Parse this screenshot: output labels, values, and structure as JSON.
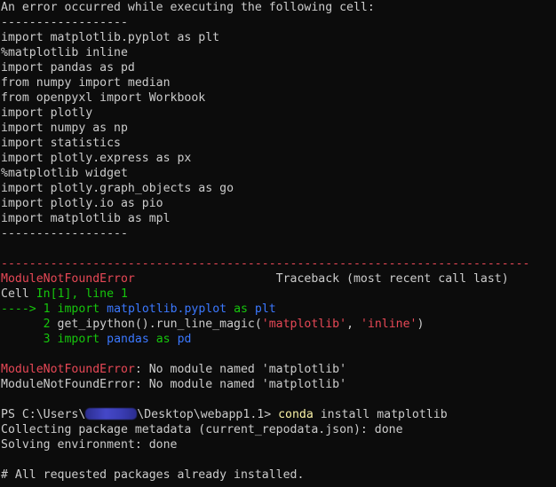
{
  "error_header": {
    "intro": "An error occurred while executing the following cell:",
    "separator_top": "------------------",
    "code_lines": [
      "import matplotlib.pyplot as plt",
      "%matplotlib inline",
      "import pandas as pd",
      "from numpy import median",
      "from openpyxl import Workbook",
      "import plotly",
      "import numpy as np",
      "import statistics",
      "import plotly.express as px",
      "%matplotlib widget",
      "import plotly.graph_objects as go",
      "import plotly.io as pio",
      "import matplotlib as mpl"
    ],
    "separator_bottom": "------------------"
  },
  "traceback": {
    "rule": "---------------------------------------------------------------------------",
    "error_name": "ModuleNotFoundError",
    "traceback_label": "Traceback (most recent call last)",
    "cell_prefix": "Cell ",
    "cell_ref": "In[1], line 1",
    "arrow": "----> 1 ",
    "line1_kw": "import",
    "line1_mod": "matplotlib.pyplot",
    "line1_as": "as",
    "line1_alias": "plt",
    "line2_num": "      2 ",
    "line2_call": "get_ipython().run_line_magic(",
    "line2_arg1": "'matplotlib'",
    "line2_sep": ", ",
    "line2_arg2": "'inline'",
    "line2_close": ")",
    "line3_num": "      3 ",
    "line3_kw": "import",
    "line3_mod": "pandas",
    "line3_as": "as",
    "line3_alias": "pd",
    "msg_name": "ModuleNotFoundError",
    "msg_text": ": No module named 'matplotlib'",
    "plain_msg": "ModuleNotFoundError: No module named 'matplotlib'"
  },
  "shell": {
    "prompt_prefix": "PS C:\\Users\\",
    "prompt_suffix": "\\Desktop\\webapp1.1> ",
    "command": "conda",
    "command_args": " install matplotlib",
    "out1": "Collecting package metadata (current_repodata.json): done",
    "out2": "Solving environment: done",
    "out3": "# All requested packages already installed."
  },
  "colors": {
    "background": "#0c0c0c",
    "text": "#cccccc",
    "error_red": "#e74856",
    "green": "#16c60c",
    "blue": "#3b78ff",
    "command_yellow": "#f9f1a5"
  }
}
